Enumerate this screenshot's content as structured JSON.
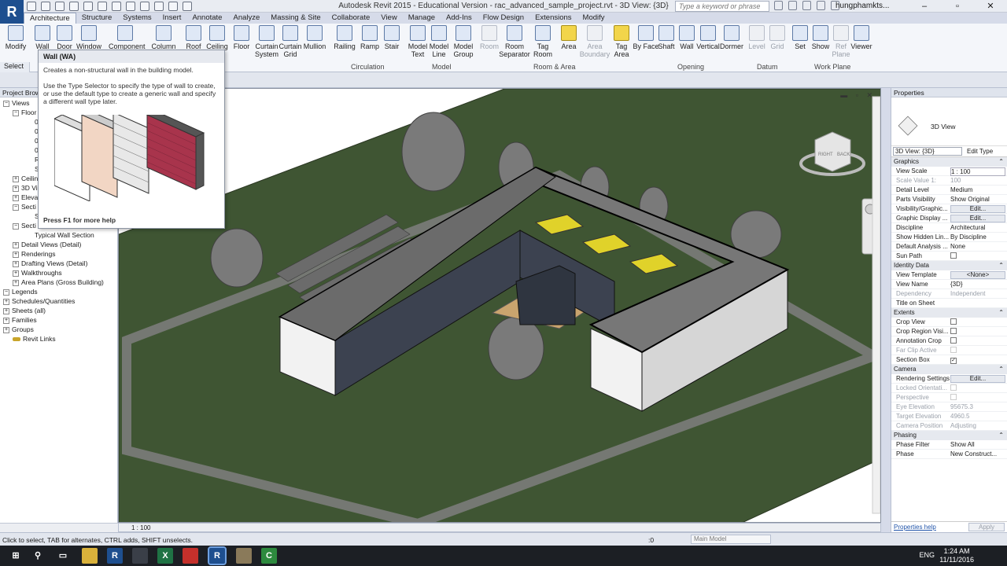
{
  "app": {
    "logo": "R",
    "window_title": "Autodesk Revit 2015 - Educational Version -    rac_advanced_sample_project.rvt - 3D View: {3D}",
    "search_placeholder": "Type a keyword or phrase",
    "user": "hungphamkts..."
  },
  "ribbon": {
    "tabs": [
      "Architecture",
      "Structure",
      "Systems",
      "Insert",
      "Annotate",
      "Analyze",
      "Massing & Site",
      "Collaborate",
      "View",
      "Manage",
      "Add-Ins",
      "Flow Design",
      "Extensions",
      "Modify"
    ],
    "buttons": {
      "modify": "Modify",
      "wall": "Wall",
      "door": "Door",
      "window": "Window",
      "component": "Component",
      "column": "Column",
      "roof": "Roof",
      "ceiling": "Ceiling",
      "floor": "Floor",
      "curtain_system": "Curtain System",
      "curtain_grid": "Curtain Grid",
      "mullion": "Mullion",
      "railing": "Railing",
      "ramp": "Ramp",
      "stair": "Stair",
      "model_text": "Model Text",
      "model_line": "Model Line",
      "model_group": "Model Group",
      "room": "Room",
      "room_separator": "Room Separator",
      "tag_room": "Tag Room",
      "area": "Area",
      "area_boundary": "Area Boundary",
      "tag_area": "Tag Area",
      "by_face": "By Face",
      "shaft": "Shaft",
      "wall_opening": "Wall",
      "vertical": "Vertical",
      "dormer": "Dormer",
      "level": "Level",
      "grid": "Grid",
      "set": "Set",
      "show": "Show",
      "ref_plane": "Ref Plane",
      "viewer": "Viewer"
    },
    "panels": {
      "select": "Select",
      "circulation": "Circulation",
      "model": "Model",
      "room_area": "Room & Area",
      "opening": "Opening",
      "datum": "Datum",
      "work_plane": "Work Plane"
    }
  },
  "tooltip": {
    "title": "Wall (WA)",
    "line1": "Creates a non-structural wall in the building model.",
    "line2": "Use the Type Selector to specify the type of wall to create, or use the default type to create a generic wall and specify a different wall type later.",
    "footer": "Press F1 for more help"
  },
  "project_browser": {
    "title": "Project Brows",
    "items": [
      "Views",
      "Floor",
      "0",
      "0",
      "0",
      "0",
      "R",
      "S",
      "Ceilin",
      "3D Vi",
      "Eleva",
      "Secti",
      "S",
      "Secti",
      "Typical Wall Section",
      "Detail Views (Detail)",
      "Renderings",
      "Drafting Views (Detail)",
      "Walkthroughs",
      "Area Plans (Gross Building)",
      "Legends",
      "Schedules/Quantities",
      "Sheets (all)",
      "Families",
      "Groups",
      "Revit Links"
    ]
  },
  "viewport": {
    "scale": "1 : 100",
    "viewcube_labels": [
      "RIGHT",
      "BACK"
    ]
  },
  "properties": {
    "title": "Properties",
    "type_name": "3D View",
    "view_selector": "3D View: {3D}",
    "edit_type": "Edit Type",
    "groups": {
      "graphics": "Graphics",
      "identity": "Identity Data",
      "extents": "Extents",
      "camera": "Camera",
      "phasing": "Phasing"
    },
    "graphics_rows": [
      {
        "k": "View Scale",
        "v": "1 : 100"
      },
      {
        "k": "Scale Value    1:",
        "v": "100"
      },
      {
        "k": "Detail Level",
        "v": "Medium"
      },
      {
        "k": "Parts Visibility",
        "v": "Show Original"
      },
      {
        "k": "Visibility/Graphic...",
        "v": "Edit..."
      },
      {
        "k": "Graphic Display ...",
        "v": "Edit..."
      },
      {
        "k": "Discipline",
        "v": "Architectural"
      },
      {
        "k": "Show Hidden Lin...",
        "v": "By Discipline"
      },
      {
        "k": "Default Analysis ...",
        "v": "None"
      },
      {
        "k": "Sun Path",
        "v": ""
      }
    ],
    "identity_rows": [
      {
        "k": "View Template",
        "v": "<None>"
      },
      {
        "k": "View Name",
        "v": "{3D}"
      },
      {
        "k": "Dependency",
        "v": "Independent"
      },
      {
        "k": "Title on Sheet",
        "v": ""
      }
    ],
    "extents_rows": [
      {
        "k": "Crop View",
        "v": ""
      },
      {
        "k": "Crop Region Visi...",
        "v": ""
      },
      {
        "k": "Annotation Crop",
        "v": ""
      },
      {
        "k": "Far Clip Active",
        "v": ""
      },
      {
        "k": "Section Box",
        "v": ""
      }
    ],
    "camera_rows": [
      {
        "k": "Rendering Settings",
        "v": "Edit..."
      },
      {
        "k": "Locked Orientati...",
        "v": ""
      },
      {
        "k": "Perspective",
        "v": ""
      },
      {
        "k": "Eye Elevation",
        "v": "95675.3"
      },
      {
        "k": "Target Elevation",
        "v": "4960.5"
      },
      {
        "k": "Camera Position",
        "v": "Adjusting"
      }
    ],
    "phasing_rows": [
      {
        "k": "Phase Filter",
        "v": "Show All"
      },
      {
        "k": "Phase",
        "v": "New Construct..."
      }
    ],
    "help": "Properties help",
    "apply": "Apply"
  },
  "status": {
    "text": "Click to select, TAB for alternates, CTRL adds, SHIFT unselects.",
    "zero": ":0",
    "model": "Main Model"
  },
  "taskbar": {
    "lang": "ENG",
    "time": "1:24 AM",
    "date": "11/11/2016"
  }
}
